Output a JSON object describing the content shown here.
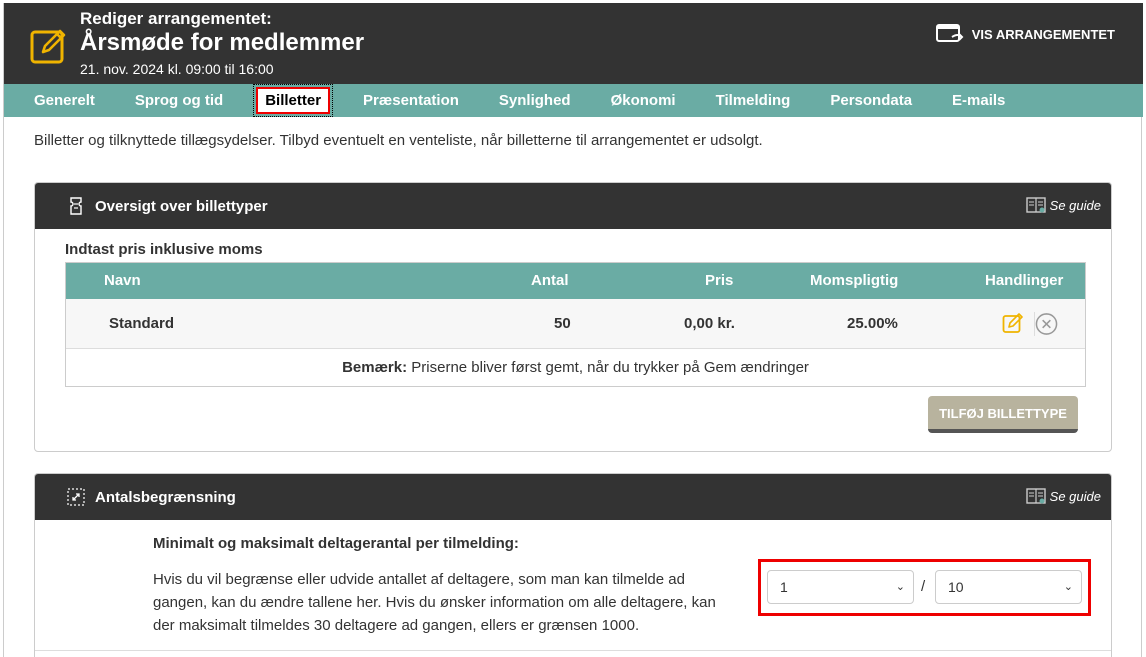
{
  "header": {
    "pre_title": "Rediger arrangementet:",
    "title": "Årsmøde for medlemmer",
    "subtitle": "21. nov. 2024 kl. 09:00 til 16:00",
    "vis_label": "VIS ARRANGEMENTET",
    "icon": "edit-icon"
  },
  "nav": {
    "items": [
      {
        "label": "Generelt"
      },
      {
        "label": "Sprog og tid"
      },
      {
        "label": "Billetter"
      },
      {
        "label": "Præsentation"
      },
      {
        "label": "Synlighed"
      },
      {
        "label": "Økonomi"
      },
      {
        "label": "Tilmelding"
      },
      {
        "label": "Persondata"
      },
      {
        "label": "E-mails"
      }
    ],
    "active": "Billetter"
  },
  "intro": "Billetter og tilknyttede tillægsydelser. Tilbyd eventuelt en venteliste, når billetterne til arrangementet er udsolgt.",
  "panel1": {
    "title": "Oversigt over billettyper",
    "guide": "Se guide",
    "label": "Indtast pris inklusive moms",
    "columns": {
      "navn": "Navn",
      "antal": "Antal",
      "pris": "Pris",
      "moms": "Momspligtig",
      "handlinger": "Handlinger"
    },
    "rows": [
      {
        "navn": "Standard",
        "antal": "50",
        "pris": "0,00 kr.",
        "moms": "25.00%"
      }
    ],
    "note_bold": "Bemærk:",
    "note_text": " Priserne bliver først gemt, når du trykker på Gem ændringer",
    "add_button": "TILFØJ BILLETTYPE"
  },
  "panel2": {
    "title": "Antalsbegrænsning",
    "guide": "Se guide",
    "sub_head": "Minimalt og maksimalt deltagerantal per tilmelding:",
    "desc": "Hvis du vil begrænse eller udvide antallet af deltagere, som man kan tilmelde ad gangen, kan du ændre tallene her. Hvis du ønsker information om alle deltagere, kan der maksimalt tilmeldes 30 deltagere ad gangen, ellers er grænsen 1000.",
    "min_value": "1",
    "separator": "/",
    "max_value": "10"
  },
  "colors": {
    "header_bg": "#333333",
    "nav_bg": "#6aaca4",
    "accent_yellow": "#f0b400",
    "highlight_red": "#e00000",
    "button_bg": "#b8b39e"
  }
}
